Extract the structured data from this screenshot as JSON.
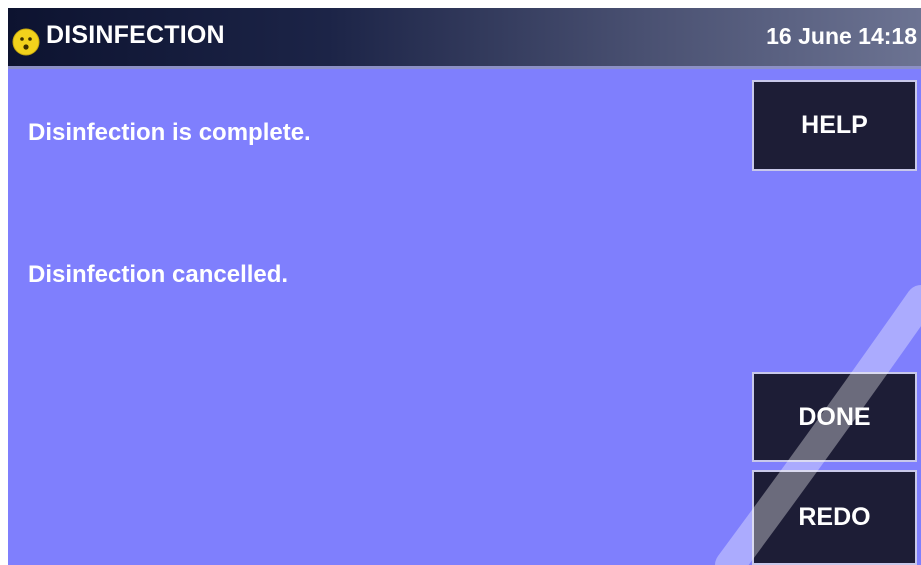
{
  "header": {
    "title": "DISINFECTION",
    "datetime": "16 June 14:18",
    "status_icon": "smiley-face-icon"
  },
  "messages": [
    "Disinfection is complete.",
    "Disinfection cancelled."
  ],
  "buttons": {
    "help": "HELP",
    "done": "DONE",
    "redo": "REDO"
  },
  "colors": {
    "screen_background": "#7f7ffd",
    "button_background": "#1d1d36",
    "header_dark": "#0d1330",
    "face_yellow": "#f2d21c"
  }
}
